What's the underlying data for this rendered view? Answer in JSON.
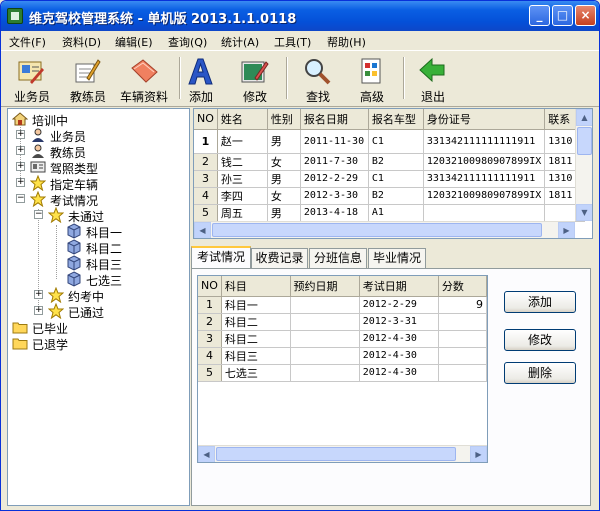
{
  "window": {
    "title": "维克驾校管理系统 - 单机版 2013.1.1.0118",
    "min": "_",
    "max": "□",
    "close": "×"
  },
  "menu": [
    "文件(F)",
    "资料(D)",
    "编辑(E)",
    "查询(Q)",
    "统计(A)",
    "工具(T)",
    "帮助(H)"
  ],
  "toolbar": {
    "items": [
      {
        "label": "业务员",
        "icon": "salesperson-icon"
      },
      {
        "label": "教练员",
        "icon": "coach-icon"
      },
      {
        "label": "车辆资料",
        "icon": "vehicle-folder-icon"
      },
      {
        "label": "添加",
        "icon": "add-icon"
      },
      {
        "label": "修改",
        "icon": "edit-icon"
      },
      {
        "label": "查找",
        "icon": "find-icon"
      },
      {
        "label": "高级",
        "icon": "advanced-icon"
      },
      {
        "label": "退出",
        "icon": "exit-arrow-icon"
      }
    ]
  },
  "tree": {
    "root": "培训中",
    "nodes": [
      "业务员",
      "教练员",
      "驾照类型",
      "指定车辆",
      "考试情况"
    ],
    "fail": "未通过",
    "subjects": [
      "科目一",
      "科目二",
      "科目三",
      "七选三"
    ],
    "booked": "约考中",
    "passed": "已通过",
    "graduated": "已毕业",
    "withdrawn": "已退学",
    "plus": "+",
    "minus": "−"
  },
  "students": {
    "columns": [
      "NO",
      "姓名",
      "性别",
      "报名日期",
      "报名车型",
      "身份证号",
      "联系"
    ],
    "rows": [
      {
        "no": "1",
        "name": "赵一",
        "gender": "男",
        "date": "2011-11-30",
        "type": "C1",
        "id": "331342111111111911",
        "phone": "1310"
      },
      {
        "no": "2",
        "name": "钱二",
        "gender": "女",
        "date": "2011-7-30",
        "type": "B2",
        "id": "12032100980907899IX",
        "phone": "1811"
      },
      {
        "no": "3",
        "name": "孙三",
        "gender": "男",
        "date": "2012-2-29",
        "type": "C1",
        "id": "331342111111111911",
        "phone": "1310"
      },
      {
        "no": "4",
        "name": "李四",
        "gender": "女",
        "date": "2012-3-30",
        "type": "B2",
        "id": "12032100980907899IX",
        "phone": "1811"
      },
      {
        "no": "5",
        "name": "周五",
        "gender": "男",
        "date": "2013-4-18",
        "type": "A1",
        "id": "",
        "phone": ""
      }
    ]
  },
  "tabs": [
    "考试情况",
    "收费记录",
    "分班信息",
    "毕业情况"
  ],
  "exams": {
    "columns": [
      "NO",
      "科目",
      "预约日期",
      "考试日期",
      "分数"
    ],
    "rows": [
      {
        "no": "1",
        "subject": "科目一",
        "booked": "",
        "date": "2012-2-29",
        "score": "9"
      },
      {
        "no": "2",
        "subject": "科目二",
        "booked": "",
        "date": "2012-3-31",
        "score": ""
      },
      {
        "no": "3",
        "subject": "科目二",
        "booked": "",
        "date": "2012-4-30",
        "score": ""
      },
      {
        "no": "4",
        "subject": "科目三",
        "booked": "",
        "date": "2012-4-30",
        "score": ""
      },
      {
        "no": "5",
        "subject": "七选三",
        "booked": "",
        "date": "2012-4-30",
        "score": ""
      }
    ]
  },
  "buttons": {
    "add": "添加",
    "edit": "修改",
    "delete": "删除"
  },
  "scroll": {
    "up": "▲",
    "down": "▼",
    "left": "◀",
    "right": "▶"
  }
}
